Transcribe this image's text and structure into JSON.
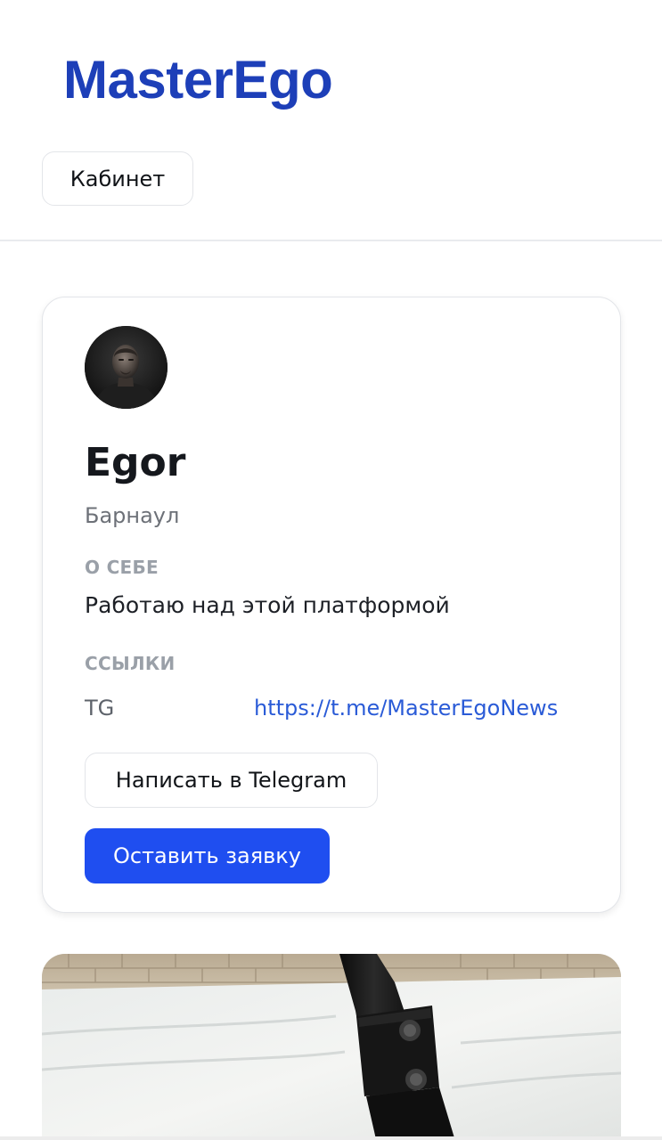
{
  "header": {
    "logo": "MasterEgo",
    "cabinet_label": "Кабинет"
  },
  "profile": {
    "name": "Egor",
    "city": "Барнаул",
    "about_label": "О СЕБЕ",
    "about_text": "Работаю над этой платформой",
    "links_label": "ССЫЛКИ",
    "links": [
      {
        "name": "TG",
        "url": "https://t.me/MasterEgoNews"
      }
    ],
    "telegram_button": "Написать в Telegram",
    "request_button": "Оставить заявку"
  },
  "colors": {
    "brand": "#1d3fb8",
    "primary_button": "#1f4ef0",
    "link": "#2a5bd7"
  }
}
